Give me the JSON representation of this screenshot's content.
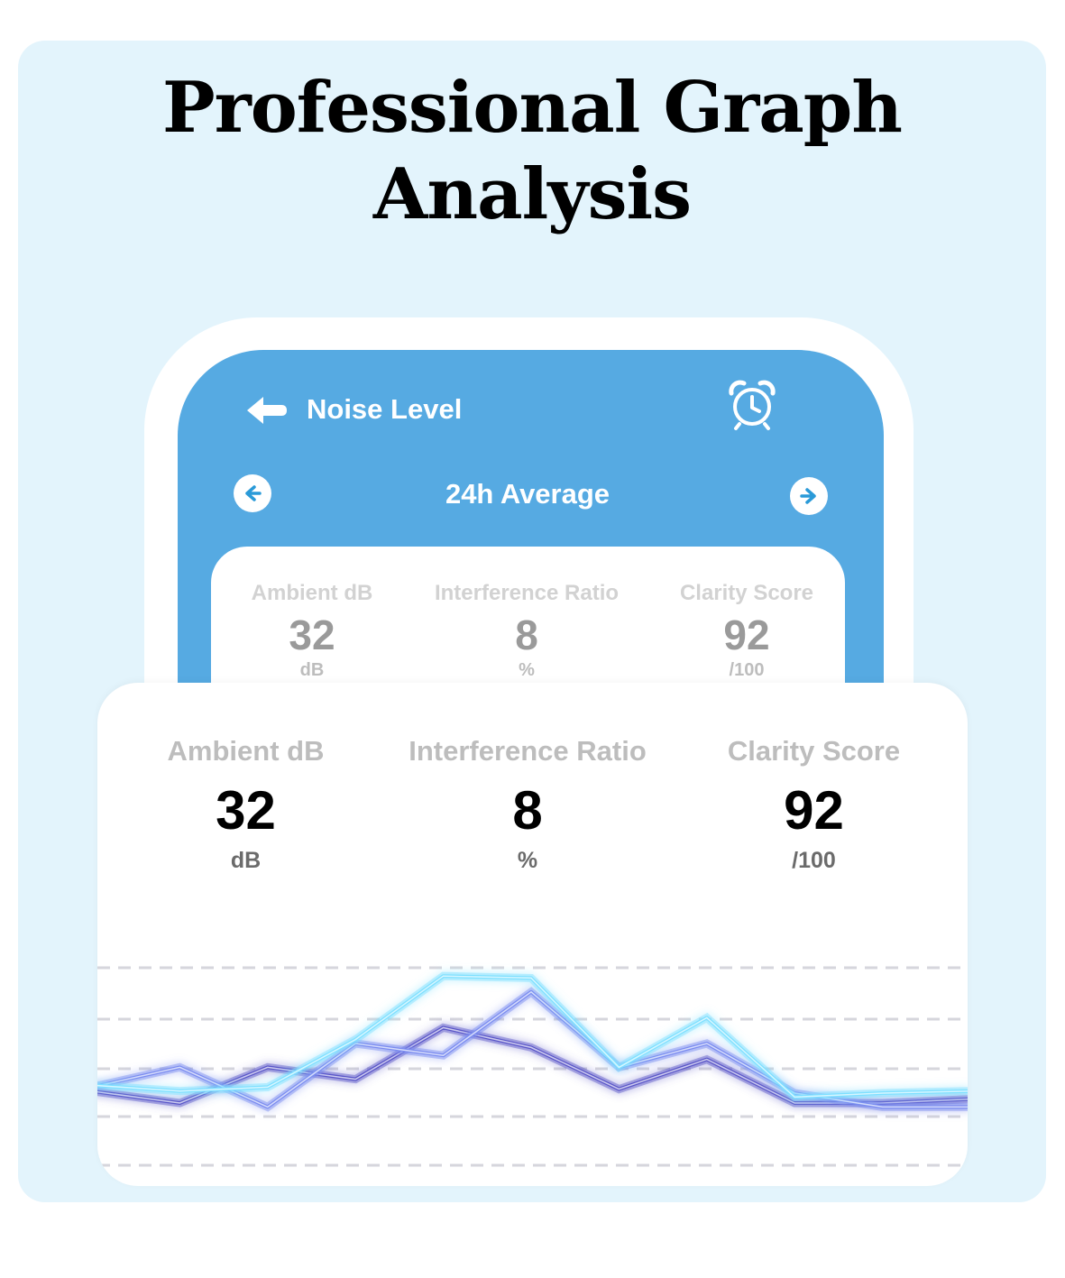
{
  "promo": {
    "title_line1": "Professional Graph",
    "title_line2": "Analysis"
  },
  "header": {
    "title": "Noise Level",
    "back_icon": "arrow-left-icon",
    "alarm_icon": "alarm-clock-icon"
  },
  "period_nav": {
    "label": "24h Average",
    "prev_icon": "arrow-left-circle-icon",
    "next_icon": "arrow-right-circle-icon"
  },
  "stats": [
    {
      "label": "Ambient dB",
      "value": "32",
      "unit": "dB"
    },
    {
      "label": "Interference Ratio",
      "value": "8",
      "unit": "%"
    },
    {
      "label": "Clarity Score",
      "value": "92",
      "unit": "/100"
    }
  ],
  "colors": {
    "panel_background": "#e3f4fc",
    "phone_blue": "#56aae2",
    "series_indigo": "#5a56c8",
    "series_violet": "#7b8cf0",
    "series_cyan": "#7ee0ff"
  },
  "chart_data": {
    "type": "line",
    "grid": true,
    "series": [
      {
        "values": [
          36,
          30,
          48,
          42,
          68,
          58,
          37,
          52,
          30,
          30,
          32
        ]
      },
      {
        "values": [
          38,
          48,
          28,
          60,
          54,
          86,
          48,
          60,
          35,
          28,
          28
        ]
      },
      {
        "values": [
          39,
          36,
          38,
          62,
          94,
          93,
          48,
          73,
          33,
          35,
          36
        ]
      }
    ]
  }
}
